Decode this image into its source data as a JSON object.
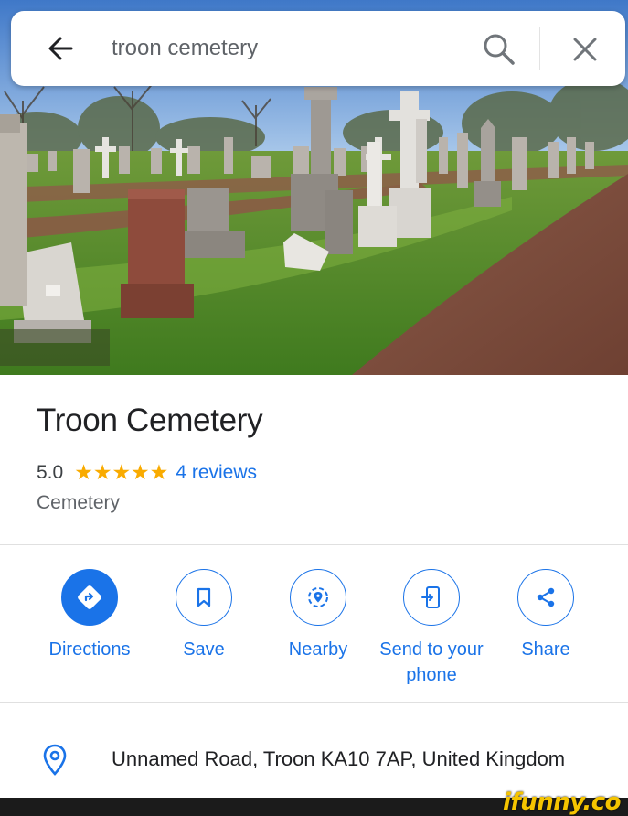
{
  "search": {
    "query": "troon cemetery",
    "back_icon": "arrow-left-icon",
    "search_icon": "magnifier-icon",
    "close_icon": "close-x-icon"
  },
  "place": {
    "name": "Troon Cemetery",
    "rating": "5.0",
    "stars": "★★★★★",
    "reviews": "4 reviews",
    "category": "Cemetery"
  },
  "actions": [
    {
      "label": "Directions",
      "icon": "directions-icon"
    },
    {
      "label": "Save",
      "icon": "bookmark-icon"
    },
    {
      "label": "Nearby",
      "icon": "nearby-icon"
    },
    {
      "label": "Send to your phone",
      "icon": "send-to-phone-icon"
    },
    {
      "label": "Share",
      "icon": "share-icon"
    }
  ],
  "address": {
    "text": "Unnamed Road, Troon KA10 7AP, United Kingdom",
    "icon": "location-pin-icon"
  },
  "watermark": "ifunny.co",
  "colors": {
    "accent": "#1a73e8",
    "star": "#f9ab00",
    "title": "#202124",
    "secondary": "#5f6368",
    "watermark": "#f5c400"
  }
}
